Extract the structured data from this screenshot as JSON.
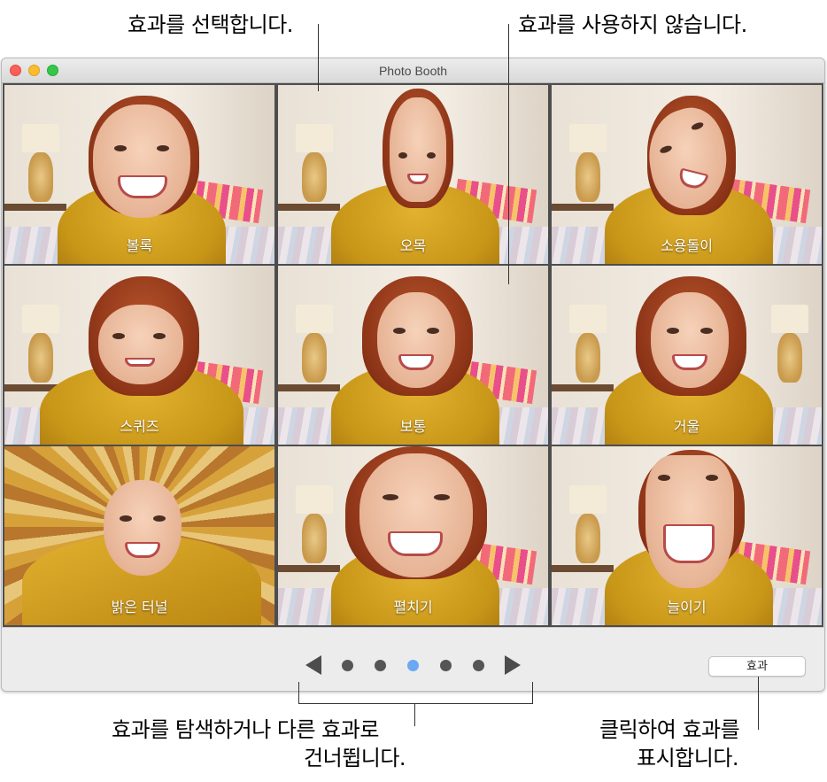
{
  "callouts": {
    "select_effect": "효과를 선택합니다.",
    "disable_effect": "효과를 사용하지 않습니다.",
    "browse_line1": "효과를 탐색하거나 다른 효과로",
    "browse_line2": "건너뜁니다.",
    "show_line1": "클릭하여 효과를",
    "show_line2": "표시합니다."
  },
  "window": {
    "title": "Photo Booth"
  },
  "effects": [
    {
      "label": "볼록"
    },
    {
      "label": "오목"
    },
    {
      "label": "소용돌이"
    },
    {
      "label": "스퀴즈"
    },
    {
      "label": "보통"
    },
    {
      "label": "거울"
    },
    {
      "label": "밝은 터널"
    },
    {
      "label": "펼치기"
    },
    {
      "label": "늘이기"
    }
  ],
  "pager": {
    "pages": 5,
    "current_page": 3,
    "active_color": "#6aa8f3",
    "prev_icon": "left-triangle-icon",
    "next_icon": "right-triangle-icon"
  },
  "effects_button": {
    "label": "효과"
  }
}
